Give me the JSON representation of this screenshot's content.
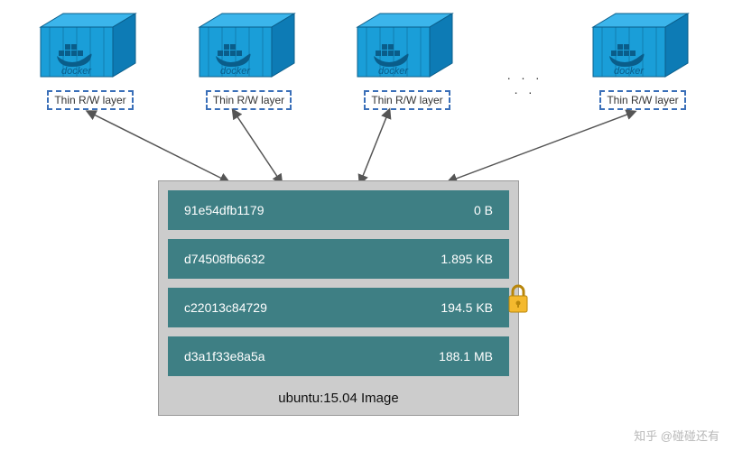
{
  "containers": {
    "rw_layer_label": "Thin R/W layer",
    "docker_label": "docker",
    "count": 4,
    "ellipsis": ". . . . ."
  },
  "image_panel": {
    "label": "ubuntu:15.04 Image",
    "layers": [
      {
        "hash": "91e54dfb1179",
        "size": "0 B"
      },
      {
        "hash": "d74508fb6632",
        "size": "1.895 KB"
      },
      {
        "hash": "c22013c84729",
        "size": "194.5 KB"
      },
      {
        "hash": "d3a1f33e8a5a",
        "size": "188.1 MB"
      }
    ]
  },
  "watermark": "知乎 @碰碰还有"
}
